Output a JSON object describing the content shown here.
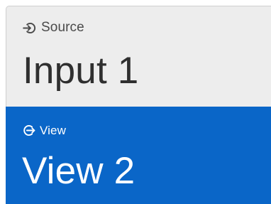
{
  "source": {
    "icon": "sign-in-icon",
    "label": "Source",
    "value": "Input 1",
    "background": "#ededed",
    "text_color": "#2f2f2f"
  },
  "view": {
    "icon": "sign-out-icon",
    "label": "View",
    "value": "View 2",
    "background": "#0a66c8",
    "text_color": "#ffffff"
  }
}
